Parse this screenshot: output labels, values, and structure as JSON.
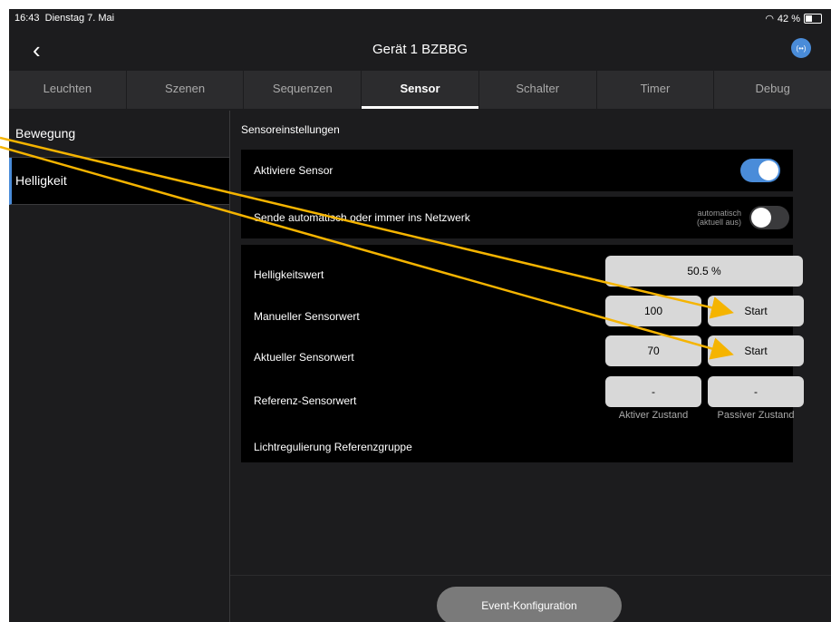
{
  "statusbar": {
    "time": "16:43",
    "date": "Dienstag 7. Mai",
    "battery": "42 %",
    "wifi_icon": "wifi-icon"
  },
  "navbar": {
    "back": "‹",
    "title": "Gerät 1 BZBBG",
    "network_icon": "(••)"
  },
  "tabs": [
    {
      "label": "Leuchten"
    },
    {
      "label": "Szenen"
    },
    {
      "label": "Sequenzen"
    },
    {
      "label": "Sensor",
      "active": true
    },
    {
      "label": "Schalter"
    },
    {
      "label": "Timer"
    },
    {
      "label": "Debug"
    }
  ],
  "sidebar": {
    "items": [
      {
        "label": "Bewegung"
      },
      {
        "label": "Helligkeit",
        "selected": true
      }
    ]
  },
  "main": {
    "section_title": "Sensoreinstellungen",
    "activate": {
      "label": "Aktiviere Sensor",
      "on": true
    },
    "send": {
      "label": "Sende automatisch oder immer ins Netzwerk",
      "note_line1": "automatisch",
      "note_line2": "(aktuell aus)",
      "on": false
    },
    "brightness": {
      "label": "Helligkeitswert",
      "value": "50.5 %"
    },
    "manual": {
      "label": "Manueller Sensorwert",
      "value": "100",
      "button": "Start"
    },
    "current": {
      "label": "Aktueller Sensorwert",
      "value": "70",
      "button": "Start"
    },
    "reference": {
      "label": "Referenz-Sensorwert",
      "active_value": "-",
      "passive_value": "-",
      "active_label": "Aktiver Zustand",
      "passive_label": "Passiver Zustand"
    },
    "light_reg": {
      "label": "Lichtregulierung Referenzgruppe"
    }
  },
  "footer": {
    "button": "Event-Konfiguration"
  },
  "colors": {
    "accent": "#4a8cd9",
    "arrow": "#f5b400",
    "background": "#1c1c1e"
  }
}
